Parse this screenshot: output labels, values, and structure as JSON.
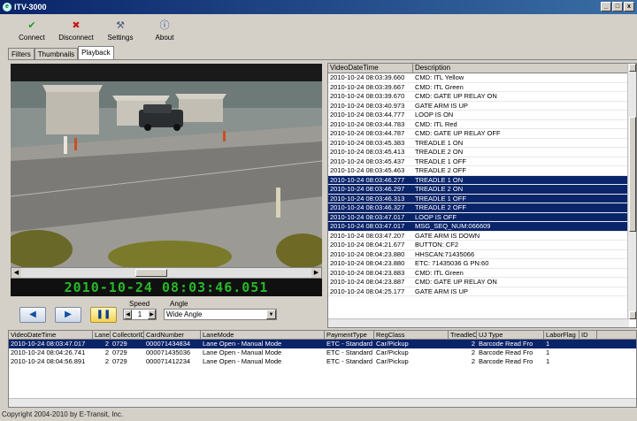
{
  "window": {
    "title": "ITV-3000",
    "buttons": [
      "_",
      "□",
      "x"
    ]
  },
  "toolbar": {
    "items": [
      {
        "label": "Connect",
        "icon": "check-icon",
        "glyph": "✔",
        "color": "#1f9a2a"
      },
      {
        "label": "Disconnect",
        "icon": "x-icon",
        "glyph": "✖",
        "color": "#c81818"
      },
      {
        "label": "Settings",
        "icon": "wrench-icon",
        "glyph": "⚒",
        "color": "#4a5a7a"
      },
      {
        "label": "About",
        "icon": "info-icon",
        "glyph": "ⓘ",
        "color": "#2a4a9a"
      }
    ]
  },
  "tabs": [
    {
      "label": "Filters",
      "active": false
    },
    {
      "label": "Thumbnails",
      "active": false
    },
    {
      "label": "Playback",
      "active": true
    }
  ],
  "video": {
    "timestamp": "2010-10-24 08:03:46.051"
  },
  "playback": {
    "speed_label": "Speed",
    "speed_value": "1",
    "angle_label": "Angle",
    "angle_value": "Wide Angle"
  },
  "events": {
    "columns": [
      "VideoDateTime",
      "Description"
    ],
    "rows": [
      {
        "time": "2010-10-24 08:03:39.660",
        "desc": "CMD: ITL Yellow",
        "sel": false
      },
      {
        "time": "2010-10-24 08:03:39.667",
        "desc": "CMD: ITL Green",
        "sel": false
      },
      {
        "time": "2010-10-24 08:03:39.670",
        "desc": "CMD: GATE UP RELAY ON",
        "sel": false
      },
      {
        "time": "2010-10-24 08:03:40.973",
        "desc": "GATE ARM IS UP",
        "sel": false
      },
      {
        "time": "2010-10-24 08:03:44.777",
        "desc": "LOOP IS ON",
        "sel": false
      },
      {
        "time": "2010-10-24 08:03:44.783",
        "desc": "CMD: ITL Red",
        "sel": false
      },
      {
        "time": "2010-10-24 08:03:44.787",
        "desc": "CMD: GATE UP RELAY OFF",
        "sel": false
      },
      {
        "time": "2010-10-24 08:03:45.383",
        "desc": "TREADLE 1 ON",
        "sel": false
      },
      {
        "time": "2010-10-24 08:03:45.413",
        "desc": "TREADLE 2 ON",
        "sel": false
      },
      {
        "time": "2010-10-24 08:03:45.437",
        "desc": "TREADLE 1 OFF",
        "sel": false
      },
      {
        "time": "2010-10-24 08:03:45.463",
        "desc": "TREADLE 2 OFF",
        "sel": false
      },
      {
        "time": "2010-10-24 08:03:46.277",
        "desc": "TREADLE 1 ON",
        "sel": true
      },
      {
        "time": "2010-10-24 08:03:46.297",
        "desc": "TREADLE 2 ON",
        "sel": true
      },
      {
        "time": "2010-10-24 08:03:46.313",
        "desc": "TREADLE 1 OFF",
        "sel": true
      },
      {
        "time": "2010-10-24 08:03:46.327",
        "desc": "TREADLE 2 OFF",
        "sel": true
      },
      {
        "time": "2010-10-24 08:03:47.017",
        "desc": "LOOP IS OFF",
        "sel": true
      },
      {
        "time": "2010-10-24 08:03:47.017",
        "desc": "MSG_SEQ_NUM:066609",
        "sel": true
      },
      {
        "time": "2010-10-24 08:03:47.207",
        "desc": "GATE ARM IS DOWN",
        "sel": false
      },
      {
        "time": "2010-10-24 08:04:21.677",
        "desc": "BUTTON: CF2",
        "sel": false
      },
      {
        "time": "2010-10-24 08:04:23.880",
        "desc": "HHSCAN:71435066",
        "sel": false
      },
      {
        "time": "2010-10-24 08:04:23.880",
        "desc": "ETC: 71435036 G PN:60",
        "sel": false
      },
      {
        "time": "2010-10-24 08:04:23.883",
        "desc": "CMD: ITL Green",
        "sel": false
      },
      {
        "time": "2010-10-24 08:04:23.887",
        "desc": "CMD: GATE UP RELAY ON",
        "sel": false
      },
      {
        "time": "2010-10-24 08:04:25.177",
        "desc": "GATE ARM IS UP",
        "sel": false
      }
    ]
  },
  "transactions": {
    "columns": [
      "VideoDateTime",
      "LaneID",
      "CollectorID",
      "CardNumber",
      "LaneMode",
      "PaymentType",
      "RegClass",
      "TreadleCnt",
      "UJ Type",
      "LaborFlag",
      "ID"
    ],
    "rows": [
      {
        "sel": true,
        "cells": [
          "2010-10-24 08:03:47.017",
          "2",
          "0729",
          "000071434834",
          "Lane Open - Manual Mode",
          "ETC - Standard",
          "Car/Pickup",
          "2",
          "Barcode Read Fro",
          "1",
          ""
        ]
      },
      {
        "sel": false,
        "cells": [
          "2010-10-24 08:04:26.741",
          "2",
          "0729",
          "000071435036",
          "Lane Open - Manual Mode",
          "ETC - Standard",
          "Car/Pickup",
          "2",
          "Barcode Read Fro",
          "1",
          ""
        ]
      },
      {
        "sel": false,
        "cells": [
          "2010-10-24 08:04:56.891",
          "2",
          "0729",
          "000071412234",
          "Lane Open - Manual Mode",
          "ETC - Standard",
          "Car/Pickup",
          "2",
          "Barcode Read Fro",
          "1",
          ""
        ]
      }
    ]
  },
  "status": {
    "copyright": "Copyright 2004-2010 by E-Transit, Inc."
  }
}
